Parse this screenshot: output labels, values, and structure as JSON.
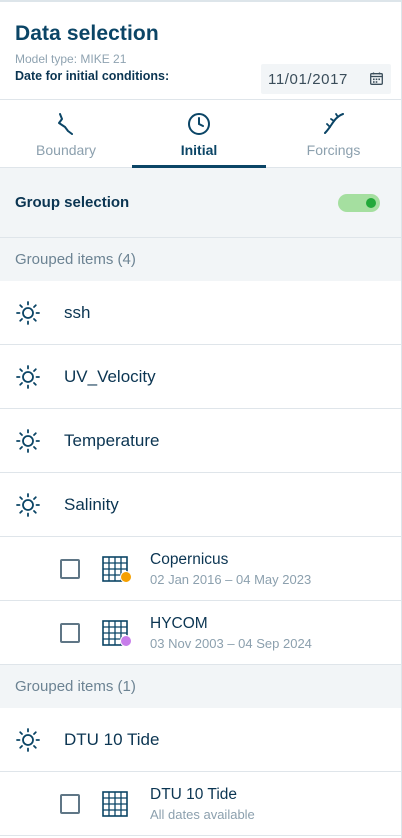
{
  "header": {
    "title": "Data selection",
    "model_type": "Model type: MIKE 21",
    "date_label": "Date for initial conditions:",
    "date_value": "11/01/2017",
    "calendar_icon": "calendar-icon"
  },
  "tabs": [
    {
      "label": "Boundary",
      "icon": "boundary-line-icon",
      "active": false
    },
    {
      "label": "Initial",
      "icon": "clock-icon",
      "active": true
    },
    {
      "label": "Forcings",
      "icon": "forcings-line-icon",
      "active": false
    }
  ],
  "group_selection": {
    "label": "Group selection",
    "enabled": true,
    "toggle_color": "#22a93a"
  },
  "groups": [
    {
      "header": "Grouped items (4)",
      "items": [
        {
          "label": "ssh",
          "icon": "sun-icon"
        },
        {
          "label": "UV_Velocity",
          "icon": "sun-icon"
        },
        {
          "label": "Temperature",
          "icon": "sun-icon"
        },
        {
          "label": "Salinity",
          "icon": "sun-icon"
        }
      ],
      "sources": [
        {
          "name": "Copernicus",
          "dates": "02 Jan 2016 – 04 May 2023",
          "dot_color": "#f5a000",
          "checked": false,
          "icon": "grid-icon"
        },
        {
          "name": "HYCOM",
          "dates": "03 Nov 2003 – 04 Sep 2024",
          "dot_color": "#c77dea",
          "checked": false,
          "icon": "grid-icon"
        }
      ]
    },
    {
      "header": "Grouped items (1)",
      "items": [
        {
          "label": "DTU 10 Tide",
          "icon": "sun-icon"
        }
      ],
      "sources": [
        {
          "name": "DTU 10 Tide",
          "dates": "All dates available",
          "dot_color": "",
          "checked": false,
          "icon": "grid-icon"
        }
      ]
    }
  ]
}
